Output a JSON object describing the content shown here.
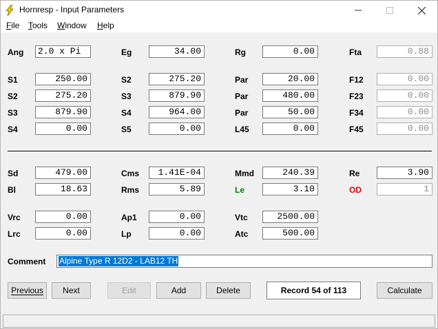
{
  "window": {
    "title": "Hornresp - Input Parameters"
  },
  "menu": [
    {
      "key": "F",
      "rest": "ile"
    },
    {
      "key": "T",
      "rest": "ools"
    },
    {
      "key": "W",
      "rest": "indow"
    },
    {
      "key": "H",
      "rest": "elp"
    }
  ],
  "params": {
    "ang": {
      "label": "Ang",
      "value": "2.0 x Pi"
    },
    "eg": {
      "label": "Eg",
      "value": "34.00"
    },
    "rg": {
      "label": "Rg",
      "value": "0.00"
    },
    "fta": {
      "label": "Fta",
      "value": "0.88"
    },
    "s1_left": {
      "label": "S1",
      "value": "250.00"
    },
    "s2_mid1": {
      "label": "S2",
      "value": "275.20"
    },
    "par1": {
      "label": "Par",
      "value": "20.00"
    },
    "f12": {
      "label": "F12",
      "value": "0.00"
    },
    "s2_left": {
      "label": "S2",
      "value": "275.20"
    },
    "s3_mid": {
      "label": "S3",
      "value": "879.90"
    },
    "par2": {
      "label": "Par",
      "value": "480.00"
    },
    "f23": {
      "label": "F23",
      "value": "0.00"
    },
    "s3_left": {
      "label": "S3",
      "value": "879.90"
    },
    "s4_mid": {
      "label": "S4",
      "value": "964.00"
    },
    "par3": {
      "label": "Par",
      "value": "50.00"
    },
    "f34": {
      "label": "F34",
      "value": "0.00"
    },
    "s4_left": {
      "label": "S4",
      "value": "0.00"
    },
    "s5_mid": {
      "label": "S5",
      "value": "0.00"
    },
    "l45": {
      "label": "L45",
      "value": "0.00"
    },
    "f45": {
      "label": "F45",
      "value": "0.00"
    },
    "sd": {
      "label": "Sd",
      "value": "479.00"
    },
    "cms": {
      "label": "Cms",
      "value": "1.41E-04"
    },
    "mmd": {
      "label": "Mmd",
      "value": "240.39"
    },
    "re": {
      "label": "Re",
      "value": "3.90"
    },
    "bl": {
      "label": "Bl",
      "value": "18.63"
    },
    "rms": {
      "label": "Rms",
      "value": "5.89"
    },
    "le": {
      "label": "Le",
      "value": "3.10"
    },
    "od": {
      "label": "OD",
      "value": "1"
    },
    "vrc": {
      "label": "Vrc",
      "value": "0.00"
    },
    "ap1": {
      "label": "Ap1",
      "value": "0.00"
    },
    "vtc": {
      "label": "Vtc",
      "value": "2500.00"
    },
    "lrc": {
      "label": "Lrc",
      "value": "0.00"
    },
    "lp": {
      "label": "Lp",
      "value": "0.00"
    },
    "atc": {
      "label": "Atc",
      "value": "500.00"
    }
  },
  "comment": {
    "label": "Comment",
    "value": "Alpine Type R 12D2 - LAB12 TH"
  },
  "buttons": {
    "previous": "Previous",
    "next": "Next",
    "edit": "Edit",
    "add": "Add",
    "delete": "Delete",
    "calculate": "Calculate"
  },
  "record": "Record 54 of 113",
  "colors": {
    "le_label": "#008000",
    "od_label": "#e00000",
    "selection": "#0078d7",
    "icon_bolt": "#f5d000"
  },
  "icons": [
    "lightning-bolt-icon",
    "minimize-icon",
    "maximize-icon",
    "close-icon"
  ]
}
